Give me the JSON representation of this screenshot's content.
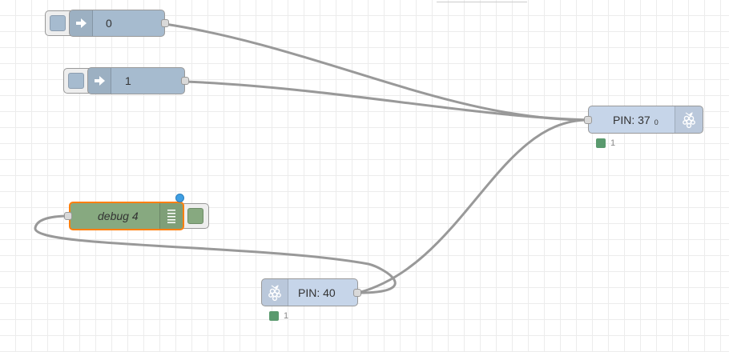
{
  "colors": {
    "inject_node": "#a6bbcf",
    "rpi_gpio_node": "#c6d5e9",
    "debug_node": "#87a980",
    "selected_outline": "#ff7f0e",
    "wire": "#999999",
    "status_connected": "#5a9a6e",
    "changed_badge": "#3f9fe3"
  },
  "nodes": {
    "inject_0": {
      "label": "0",
      "icon": "arrow-right-icon"
    },
    "inject_1": {
      "label": "1",
      "icon": "arrow-right-icon"
    },
    "gpio_out_37": {
      "label": "PIN: 37",
      "sublabel": "0",
      "icon": "raspberry-pi-icon",
      "status": "1"
    },
    "gpio_in_40": {
      "label": "PIN: 40",
      "icon": "raspberry-pi-icon",
      "status": "1"
    },
    "debug_4": {
      "label": "debug 4",
      "icon": "list-icon"
    }
  }
}
